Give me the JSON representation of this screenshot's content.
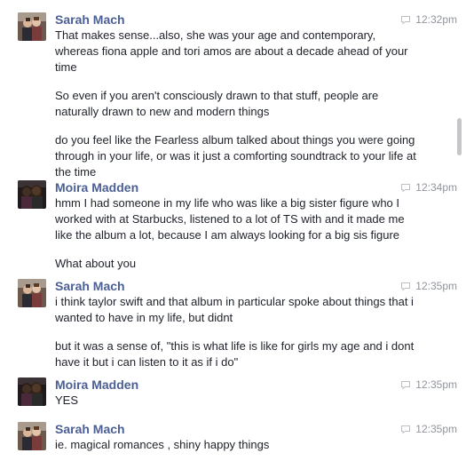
{
  "messages": [
    {
      "sender": "Sarah Mach",
      "time": "12:32pm",
      "avatar": "sarah-avatar",
      "lines": [
        "That makes sense...also, she was your age and contemporary, whereas fiona apple and tori amos are about a decade ahead of your time",
        "So even if you aren't consciously drawn to that stuff, people are naturally drawn to new and modern things",
        "do you feel like the Fearless album talked about things you were going through in your life, or was it just a comforting soundtrack to your life at the time"
      ]
    },
    {
      "sender": "Moira Madden",
      "time": "12:34pm",
      "avatar": "moira-avatar",
      "lines": [
        "hmm I had someone in my life who was like a big sister figure who I worked with at Starbucks, listened to a lot of TS with and it made me like the album a lot, because I am always looking for a big sis figure",
        "What about you"
      ]
    },
    {
      "sender": "Sarah Mach",
      "time": "12:35pm",
      "avatar": "sarah-avatar",
      "lines": [
        "i think taylor swift and that album in particular spoke about things that i wanted to have in my life, but didnt",
        "but it was a sense of, \"this is what life is like for girls my age and i dont have it but i can listen to it as if i do\""
      ]
    },
    {
      "sender": "Moira Madden",
      "time": "12:35pm",
      "avatar": "moira-avatar",
      "lines": [
        "YES"
      ]
    },
    {
      "sender": "Sarah Mach",
      "time": "12:35pm",
      "avatar": "sarah-avatar",
      "lines": [
        "ie. magical romances , shiny happy things"
      ]
    }
  ],
  "colors": {
    "sender": "#4b5f96",
    "text": "#1d2129",
    "time": "#90949c"
  }
}
